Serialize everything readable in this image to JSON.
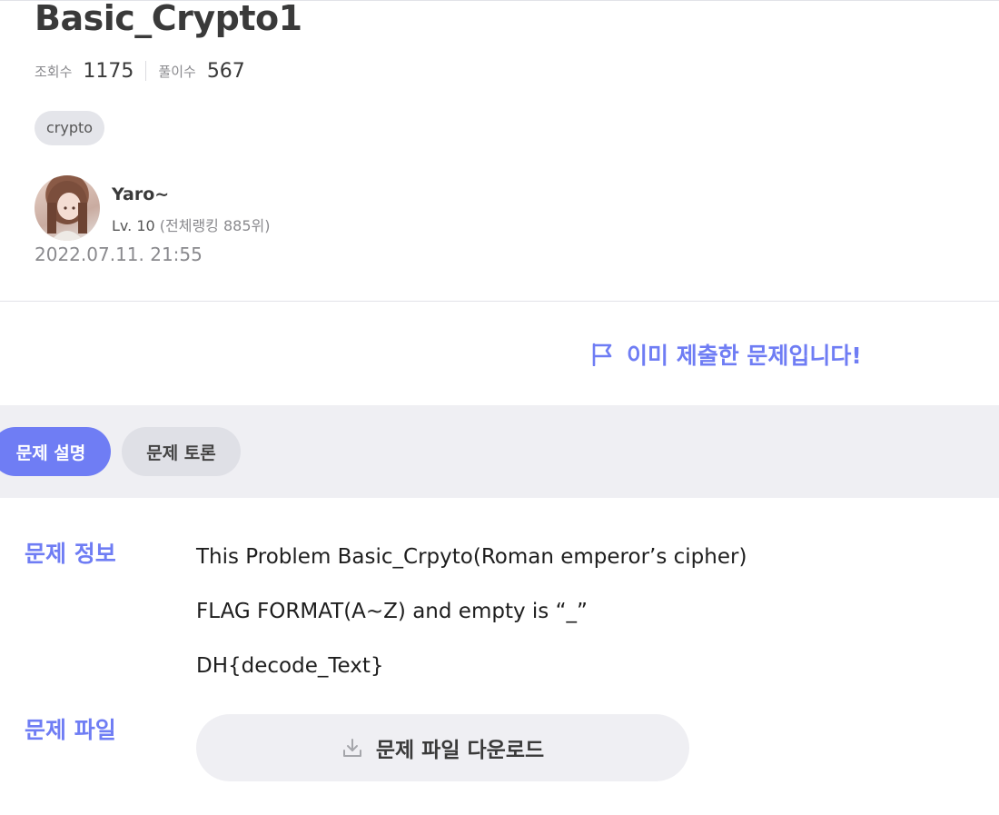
{
  "problem": {
    "title": "Basic_Crypto1",
    "views_label": "조회수",
    "views": "1175",
    "solves_label": "풀이수",
    "solves": "567",
    "tag": "crypto"
  },
  "author": {
    "name": "Yaro~",
    "level": "Lv. 10",
    "rank": "(전체랭킹 885위)",
    "date": "2022.07.11. 21:55"
  },
  "status": {
    "submitted_text": "이미 제출한 문제입니다!",
    "icon": "flag-icon"
  },
  "tabs": [
    {
      "label": "문제 설명",
      "active": true
    },
    {
      "label": "문제 토론",
      "active": false
    }
  ],
  "info": {
    "label": "문제 정보",
    "lines": [
      "This Problem Basic_Crpyto(Roman emperor’s cipher)",
      "FLAG FORMAT(A~Z) and empty is “_”",
      "DH{decode_Text}"
    ]
  },
  "file": {
    "label": "문제 파일",
    "download_label": "문제 파일 다운로드",
    "icon": "download-icon"
  },
  "colors": {
    "accent": "#6f7df4",
    "tab_bar_bg": "#efeff3",
    "tag_bg": "#e4e5ea"
  }
}
